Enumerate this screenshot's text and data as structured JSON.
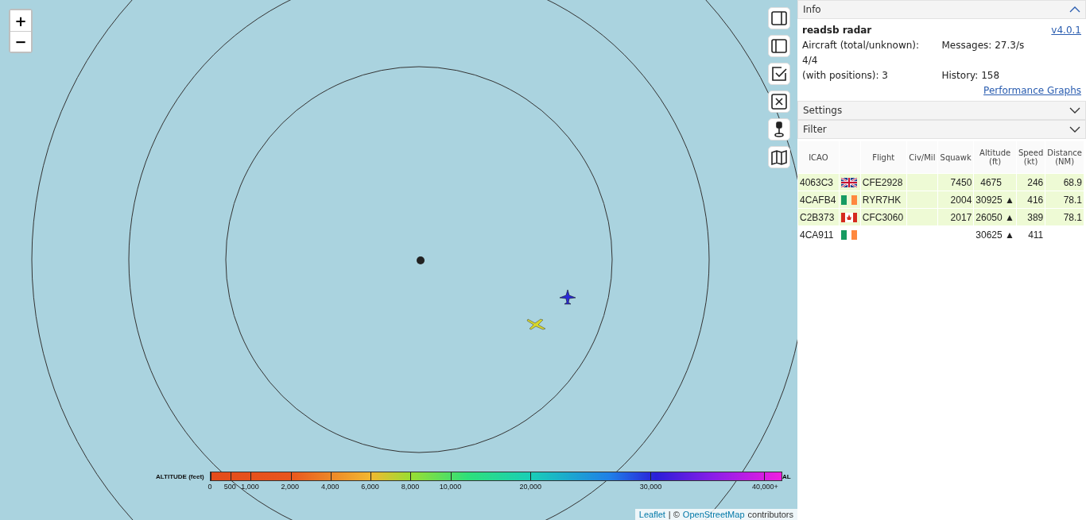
{
  "map": {
    "zoom_in": "+",
    "zoom_out": "−",
    "legend": {
      "title": "ALTITUDE (feet)",
      "ticks": [
        "0",
        "500",
        "1,000",
        "2,000",
        "4,000",
        "6,000",
        "8,000",
        "10,000",
        "20,000",
        "30,000",
        "40,000+"
      ],
      "cut_label": "AL"
    },
    "attribution": {
      "leaflet": "Leaflet",
      "separator": "| ©",
      "osm": "OpenStreetMap",
      "suffix": "contributors"
    }
  },
  "panel": {
    "info": {
      "title": "Info",
      "expanded": true,
      "name": "readsb radar",
      "version": "v4.0.1",
      "aircraft_label": "Aircraft (total/unknown):",
      "aircraft_value": "4/4",
      "positions": "(with positions): 3",
      "messages": "Messages: 27.3/s",
      "history": "History: 158",
      "graphs_link": "Performance Graphs"
    },
    "sections": [
      {
        "title": "Settings",
        "expanded": false
      },
      {
        "title": "Filter",
        "expanded": false
      }
    ],
    "table": {
      "columns": [
        {
          "kind": "text",
          "label": "ICAO"
        },
        {
          "kind": "flag"
        },
        {
          "kind": "text",
          "label": "Flight"
        },
        {
          "kind": "text",
          "label": "Civ/Mil"
        },
        {
          "kind": "text",
          "label": "Squawk"
        },
        {
          "kind": "text",
          "label": "Altitude (ft)"
        },
        {
          "kind": "text",
          "label": "Speed (kt)"
        },
        {
          "kind": "text",
          "label": "Distance (NM)"
        }
      ],
      "rows": [
        {
          "icao": "4063C3",
          "kind": "uk",
          "flight": "CFE2928",
          "squawk": "7450",
          "altitude": "4675",
          "speed": "246",
          "distance": "68.9",
          "highlighted": true
        },
        {
          "icao": "4CAFB4",
          "kind": "ie",
          "flight": "RYR7HK",
          "squawk": "2004",
          "altitude": "30925",
          "trend": "▲",
          "speed": "416",
          "distance": "78.1",
          "highlighted": true
        },
        {
          "icao": "C2B373",
          "kind": "ca",
          "flight": "CFC3060",
          "squawk": "2017",
          "altitude": "26050",
          "trend": "▲",
          "speed": "389",
          "distance": "78.1",
          "highlighted": true
        },
        {
          "icao": "4CA911",
          "kind": "ie",
          "altitude": "30625",
          "trend": "▲",
          "speed": "411",
          "highlighted": false
        }
      ]
    }
  }
}
